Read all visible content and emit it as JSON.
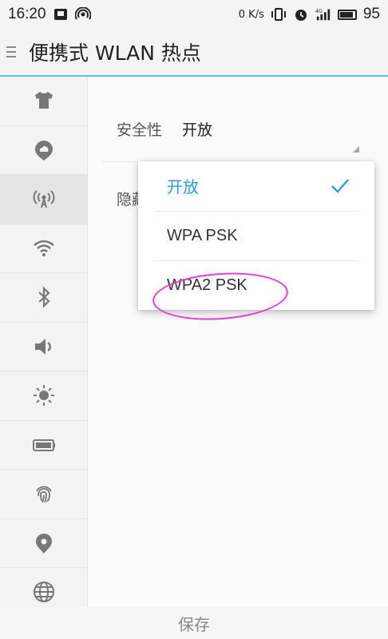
{
  "status_bar": {
    "time": "16:20",
    "speed": "0 K/s",
    "battery_level": "95",
    "icons": [
      "notification-icon",
      "hotspot-status-icon",
      "vibrate-icon",
      "alarm-icon",
      "4g-signal-icon",
      "battery-icon"
    ]
  },
  "header": {
    "title": "便携式 WLAN 热点"
  },
  "sidebar": {
    "items": [
      {
        "icon": "theme-shirt-icon"
      },
      {
        "icon": "cloud-icon"
      },
      {
        "icon": "hotspot-icon",
        "active": true
      },
      {
        "icon": "wifi-icon"
      },
      {
        "icon": "bluetooth-icon"
      },
      {
        "icon": "sound-icon"
      },
      {
        "icon": "brightness-icon"
      },
      {
        "icon": "battery-icon"
      },
      {
        "icon": "fingerprint-icon"
      },
      {
        "icon": "location-icon"
      },
      {
        "icon": "globe-icon"
      }
    ]
  },
  "settings": {
    "security_label": "安全性",
    "security_value": "开放",
    "hidden_label": "隐藏"
  },
  "dropdown": {
    "options": [
      "开放",
      "WPA PSK",
      "WPA2 PSK"
    ],
    "selected": "开放"
  },
  "footer": {
    "save_label": "保存"
  },
  "colors": {
    "accent": "#2d9ed8",
    "annotation": "#e93adb"
  }
}
